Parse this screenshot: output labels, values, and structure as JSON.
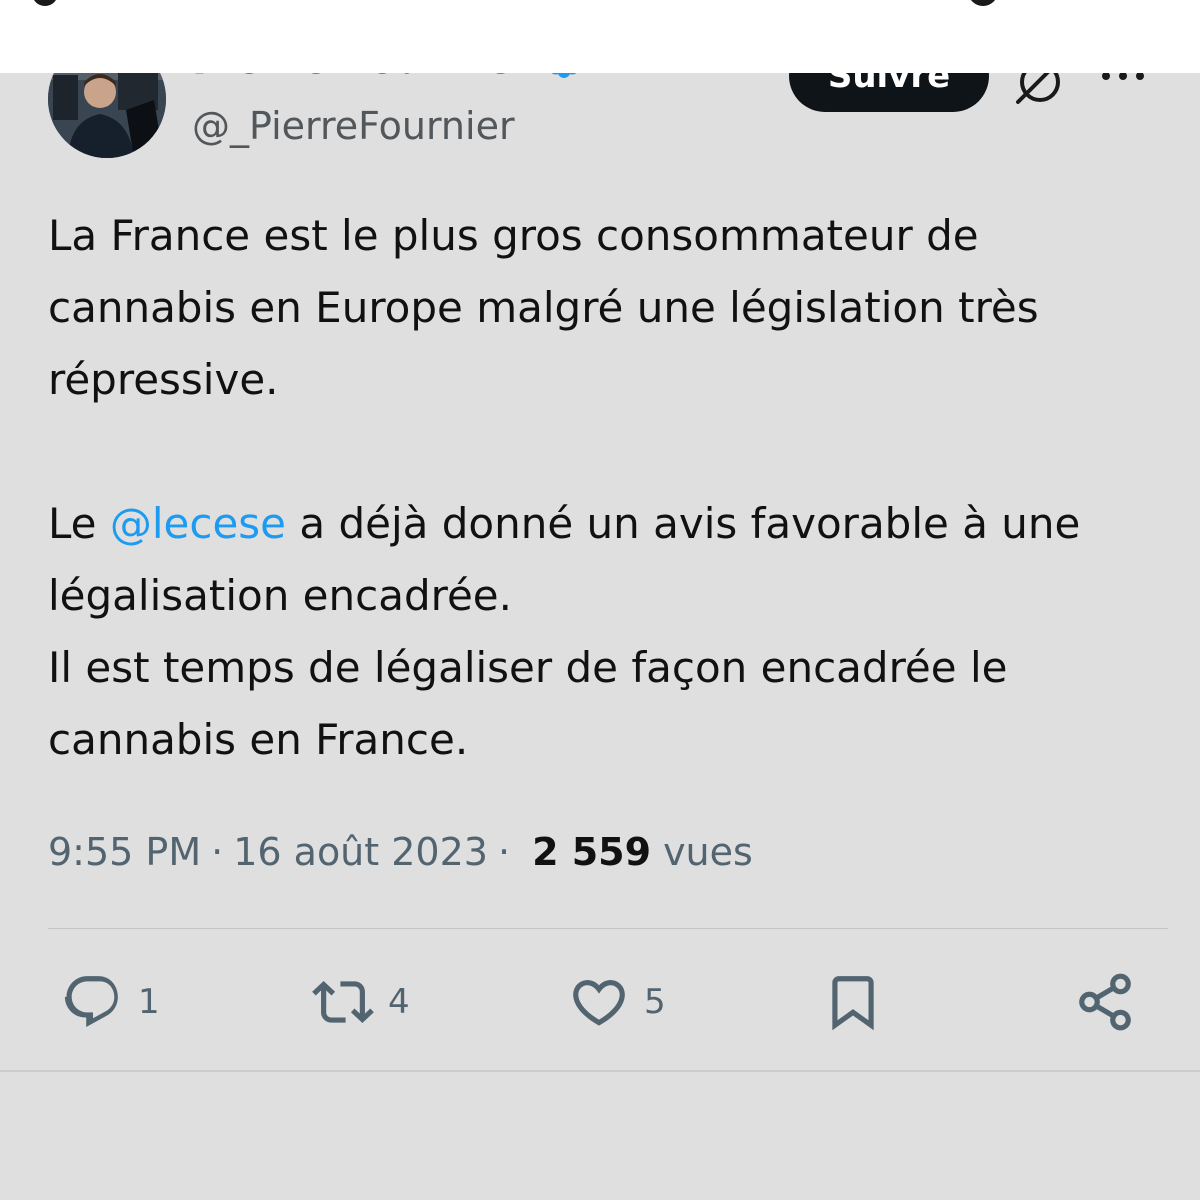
{
  "header": {
    "display_name": "Pierre Fournier",
    "handle": "@_PierreFournier",
    "follow_label": "Suivre",
    "verified": true,
    "grok_icon": "grok-slash-icon",
    "more_icon": "more-horizontal-icon"
  },
  "tweet": {
    "paragraph1": "La France est le plus gros consommateur de cannabis en Europe malgré une législation très répressive.",
    "paragraph2_before_mention": "Le ",
    "mention": "@lecese",
    "paragraph2_after_mention": " a déjà donné un avis favorable à une légalisation encadrée.",
    "paragraph3": "Il est temps de légaliser de façon encadrée le cannabis en France."
  },
  "meta": {
    "time": "9:55 PM",
    "separator": "·",
    "date": "16 août 2023",
    "views_count": "2 559",
    "views_label": "vues"
  },
  "actions": {
    "replies": "1",
    "retweets": "4",
    "likes": "5"
  },
  "colors": {
    "background": "#dfdfdf",
    "mention": "#1d9bf0",
    "verified": "#1d9bf0",
    "follow_button": "#0f1419",
    "secondary_text": "#536471"
  }
}
